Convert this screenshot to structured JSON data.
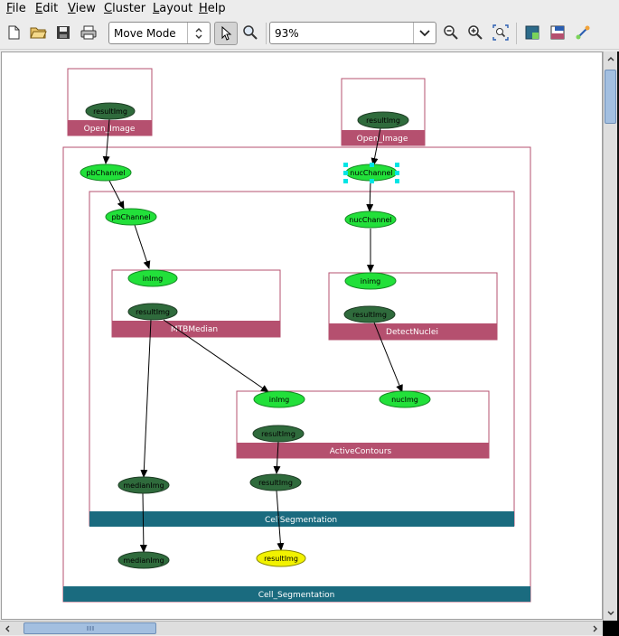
{
  "menu": [
    "File",
    "Edit",
    "View",
    "Cluster",
    "Layout",
    "Help"
  ],
  "toolbar": {
    "mode": "Move Mode",
    "zoom": "93%",
    "icons": [
      "new-icon",
      "open-folder-icon",
      "save-icon",
      "print-icon",
      "pointer-icon",
      "zoom-region-icon",
      "zoom-out-icon",
      "zoom-in-icon",
      "zoom-fit-icon",
      "layout-icon",
      "cluster-icon",
      "edge-icon"
    ]
  },
  "graph": {
    "clusters": {
      "open_image_1": "Open_Image",
      "open_image_2": "Open_Image",
      "cell_segmentation_outer": "Cell_Segmentation",
      "cell_segmentation_inner": "CellSegmentation",
      "mtb_median": "MTBMedian",
      "detect_nuclei": "DetectNuclei",
      "active_contours": "ActiveContours"
    },
    "nodes": {
      "open1_resultImg": "resultImg",
      "open2_resultImg": "resultImg",
      "outer_pbChannel": "pbChannel",
      "outer_nucChannel": "nucChannel",
      "inner_pbChannel": "pbChannel",
      "inner_nucChannel": "nucChannel",
      "mtb_inImg": "inImg",
      "mtb_resultImg": "resultImg",
      "dn_inimg": "inimg",
      "dn_resultImg": "resultImg",
      "ac_inImg": "inImg",
      "ac_nucImg": "nucImg",
      "ac_resultImg": "resultImg",
      "inner_resultImg": "resultImg",
      "inner_medianImg": "medianImg",
      "outer_medianImg": "medianImg",
      "outer_resultImg": "resultImg"
    },
    "colors": {
      "cluster_label_pink": "#b5506f",
      "cluster_label_teal": "#1a6b7f",
      "node_dark_green": "#2f6b3c",
      "node_light_green": "#22e03a",
      "node_yellow": "#f2f200",
      "selection_handle": "#00e5e5"
    }
  }
}
